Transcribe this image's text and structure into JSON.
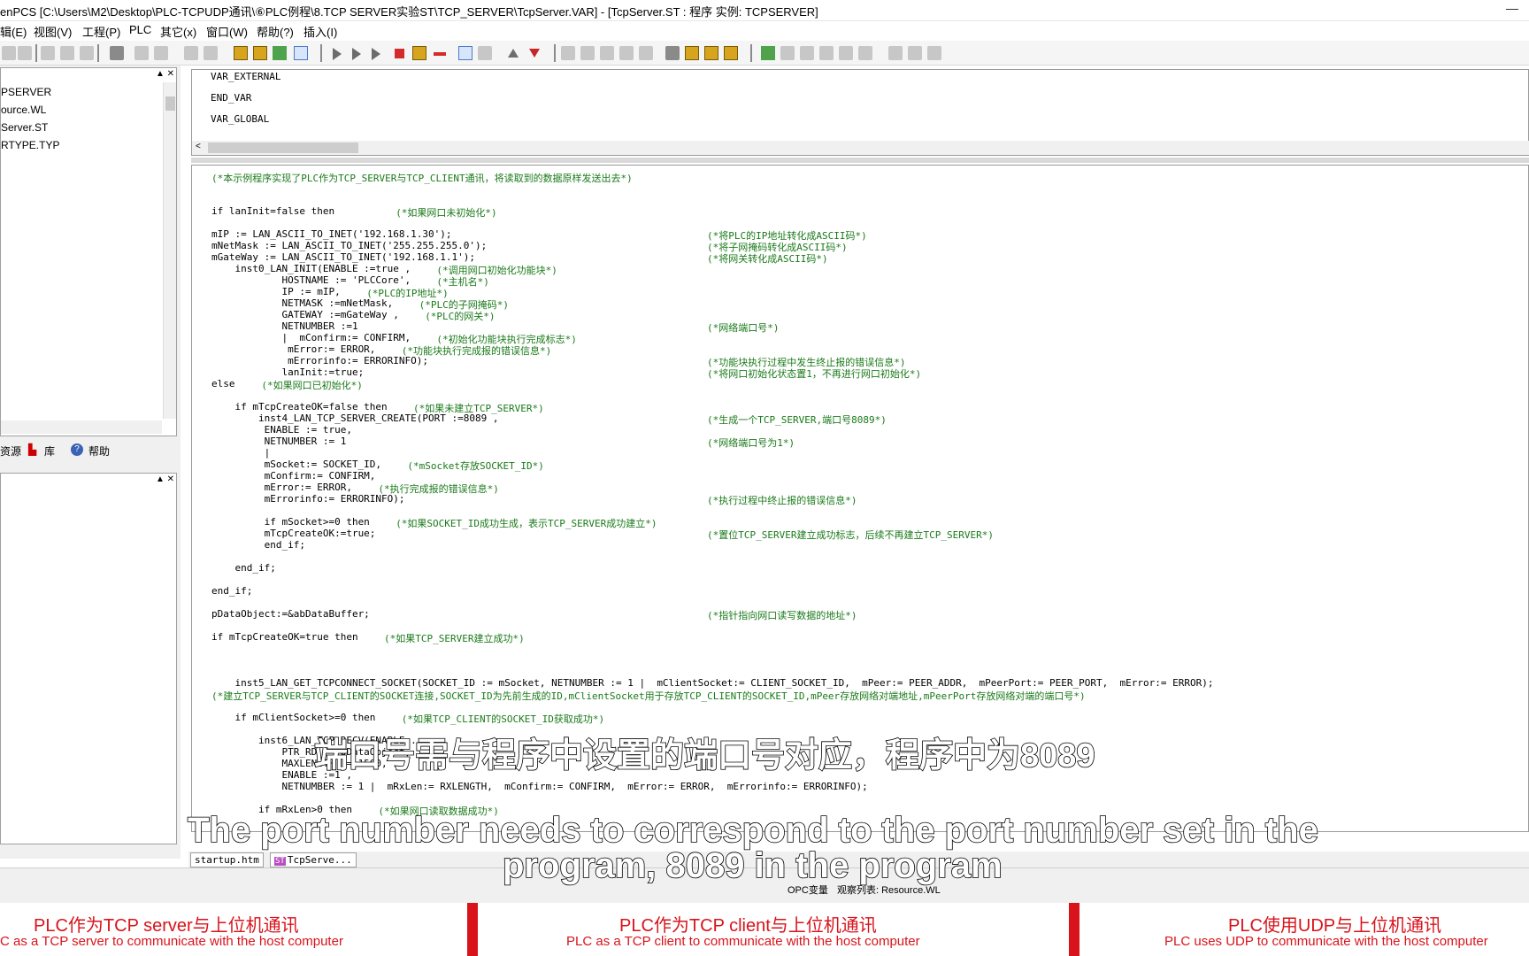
{
  "window": {
    "title": "enPCS [C:\\Users\\M2\\Desktop\\PLC-TCPUDP通讯\\⑥PLC例程\\8.TCP SERVER实验ST\\TCP_SERVER\\TcpServer.VAR]  - [TcpServer.ST : 程序   实例: TCPSERVER]"
  },
  "menu": [
    "辑(E)",
    "视图(V)",
    "工程(P)",
    "PLC",
    "其它(x)",
    "窗口(W)",
    "帮助(?)",
    "插入(I)"
  ],
  "project_tree": {
    "items": [
      "PSERVER",
      "ource.WL",
      "Server.ST",
      "RTYPE.TYP"
    ]
  },
  "left_tabs": {
    "resource": "资源",
    "library": "库",
    "help": "帮助"
  },
  "var_editor": {
    "lines": [
      "VAR_EXTERNAL",
      "END_VAR",
      "VAR_GLOBAL"
    ]
  },
  "code_lines": [
    {
      "code": "",
      "comment": "(*本示例程序实现了PLC作为TCP_SERVER与TCP_CLIENT通讯，将读取到的数据原样发送出去*)"
    },
    {
      "code": "",
      "comment": ""
    },
    {
      "code": "",
      "comment": ""
    },
    {
      "code": "if lanInit=false then      ",
      "comment": "(*如果网口未初始化*)"
    },
    {
      "code": "",
      "comment": ""
    },
    {
      "code": "mIP := LAN_ASCII_TO_INET('192.168.1.30');",
      "comment": "(*将PLC的IP地址转化成ASCII码*)"
    },
    {
      "code": "mNetMask := LAN_ASCII_TO_INET('255.255.255.0');",
      "comment": "(*将子网掩码转化成ASCII码*)"
    },
    {
      "code": "mGateWay := LAN_ASCII_TO_INET('192.168.1.1');",
      "comment": "(*将网关转化成ASCII码*)"
    },
    {
      "code": "    inst0_LAN_INIT(ENABLE :=true ,",
      "comment": "(*调用网口初始化功能块*)"
    },
    {
      "code": "            HOSTNAME := 'PLCCore',",
      "comment": "(*主机名*)"
    },
    {
      "code": "            IP := mIP,",
      "comment": "(*PLC的IP地址*)"
    },
    {
      "code": "            NETMASK :=mNetMask,",
      "comment": "(*PLC的子网掩码*)"
    },
    {
      "code": "            GATEWAY :=mGateWay ,",
      "comment": "(*PLC的网关*)"
    },
    {
      "code": "            NETNUMBER :=1",
      "comment": "(*网络端口号*)"
    },
    {
      "code": "            |  mConfirm:= CONFIRM,",
      "comment": "(*初始化功能块执行完成标志*)"
    },
    {
      "code": "             mError:= ERROR,",
      "comment": "(*功能块执行完成报的错误信息*)"
    },
    {
      "code": "             mErrorinfo:= ERRORINFO);",
      "comment": "(*功能块执行过程中发生终止报的错误信息*)"
    },
    {
      "code": "            lanInit:=true;",
      "comment": "(*将网口初始化状态置1，不再进行网口初始化*)"
    },
    {
      "code": "else",
      "comment": "(*如果网口已初始化*)"
    },
    {
      "code": "",
      "comment": ""
    },
    {
      "code": "    if mTcpCreateOK=false then",
      "comment": "(*如果未建立TCP_SERVER*)"
    },
    {
      "code": "        inst4_LAN_TCP_SERVER_CREATE(PORT :=8089 ,",
      "comment": "(*生成一个TCP_SERVER,端口号8089*)"
    },
    {
      "code": "         ENABLE := true,",
      "comment": ""
    },
    {
      "code": "         NETNUMBER := 1",
      "comment": "(*网络端口号为1*)"
    },
    {
      "code": "         |",
      "comment": ""
    },
    {
      "code": "         mSocket:= SOCKET_ID,",
      "comment": "(*mSocket存放SOCKET_ID*)"
    },
    {
      "code": "         mConfirm:= CONFIRM,",
      "comment": ""
    },
    {
      "code": "         mError:= ERROR,",
      "comment": "(*执行完成报的错误信息*)"
    },
    {
      "code": "         mErrorinfo:= ERRORINFO);",
      "comment": "(*执行过程中终止报的错误信息*)"
    },
    {
      "code": "",
      "comment": ""
    },
    {
      "code": "         if mSocket>=0 then",
      "comment": "(*如果SOCKET_ID成功生成，表示TCP_SERVER成功建立*)"
    },
    {
      "code": "         mTcpCreateOK:=true;",
      "comment": "(*置位TCP_SERVER建立成功标志，后续不再建立TCP_SERVER*)"
    },
    {
      "code": "         end_if;",
      "comment": ""
    },
    {
      "code": "",
      "comment": ""
    },
    {
      "code": "    end_if;",
      "comment": ""
    },
    {
      "code": "",
      "comment": ""
    },
    {
      "code": "end_if;",
      "comment": ""
    },
    {
      "code": "",
      "comment": ""
    },
    {
      "code": "pDataObject:=&abDataBuffer;",
      "comment": "(*指针指向网口读写数据的地址*)"
    },
    {
      "code": "",
      "comment": ""
    },
    {
      "code": "if mTcpCreateOK=true then",
      "comment": "(*如果TCP_SERVER建立成功*)"
    },
    {
      "code": "",
      "comment": ""
    },
    {
      "code": "",
      "comment": ""
    },
    {
      "code": "",
      "comment": ""
    },
    {
      "code": "    inst5_LAN_GET_TCPCONNECT_SOCKET(SOCKET_ID := mSocket, NETNUMBER := 1 |  mClientSocket:= CLIENT_SOCKET_ID,  mPeer:= PEER_ADDR,  mPeerPort:= PEER_PORT,  mError:= ERROR);",
      "comment": ""
    },
    {
      "code": "    ",
      "comment": "(*建立TCP_SERVER与TCP_CLIENT的SOCKET连接,SOCKET_ID为先前生成的ID,mClientSocket用于存放TCP_CLIENT的SOCKET_ID,mPeer存放网络对端地址,mPeerPort存放网络对端的端口号*)"
    },
    {
      "code": "",
      "comment": ""
    },
    {
      "code": "    if mClientSocket>=0 then",
      "comment": "(*如果TCP_CLIENT的SOCKET_ID获取成功*)"
    },
    {
      "code": "",
      "comment": ""
    },
    {
      "code": "        inst6_LAN_TCP_RECV(ENABLE ...",
      "comment": ""
    },
    {
      "code": "            PTR_RD := pDataObject,",
      "comment": ""
    },
    {
      "code": "            MAXLENGTH := 1500,",
      "comment": ""
    },
    {
      "code": "            ENABLE :=1 ,",
      "comment": ""
    },
    {
      "code": "            NETNUMBER := 1 |  mRxLen:= RXLENGTH,  mConfirm:= CONFIRM,  mError:= ERROR,  mErrorinfo:= ERRORINFO);",
      "comment": ""
    },
    {
      "code": "",
      "comment": ""
    },
    {
      "code": "        if mRxLen>0 then",
      "comment": "(*如果网口读取数据成功*)"
    }
  ],
  "doc_tabs": [
    "startup.htm",
    "TcpServe..."
  ],
  "doc_tab_st_badge": "ST",
  "bottom_strip": {
    "opc": "OPC变量",
    "watch": "观察列表: Resource.WL"
  },
  "subtitles": {
    "zh": "端口号需与程序中设置的端口号对应，程序中为8089",
    "en_line1": "The port number needs to correspond to the port number set in the",
    "en_line2": "program, 8089 in the program"
  },
  "banner": [
    {
      "zh": "PLC作为TCP server与上位机通讯",
      "en": "C as a TCP server to communicate with the host computer"
    },
    {
      "zh": "PLC作为TCP client与上位机通讯",
      "en": "PLC as a TCP client to communicate with the host computer"
    },
    {
      "zh": "PLC使用UDP与上位机通讯",
      "en": "PLC uses UDP to communicate with the host computer"
    }
  ],
  "colors": {
    "comment_green": "#1a7a1a",
    "banner_red": "#d9131b",
    "highlight_yellow": "#f7e600"
  }
}
